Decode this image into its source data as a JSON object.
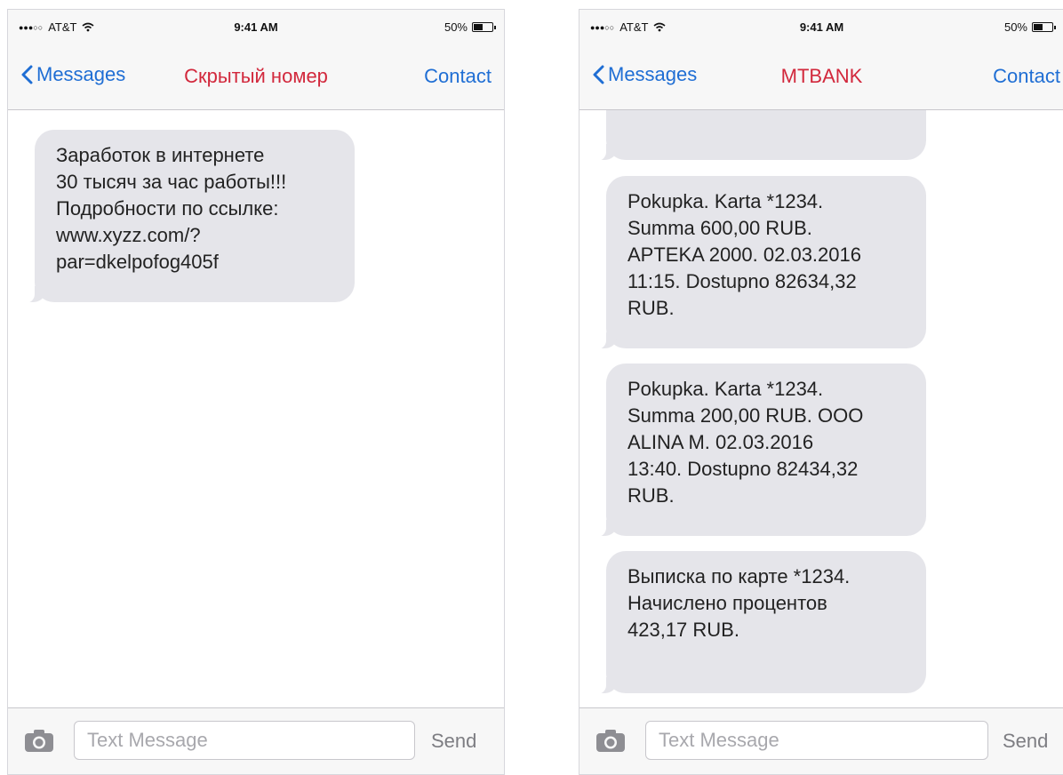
{
  "colors": {
    "nav_link": "#1f6ed4",
    "sender_title": "#d2283c",
    "bubble_incoming": "#e5e5ea",
    "bar_background": "#f7f7f7"
  },
  "phones": [
    {
      "status": {
        "carrier": "AT&T",
        "time": "9:41 AM",
        "battery": "50%",
        "battery_level": 0.5,
        "signal_dots": "●●●○○"
      },
      "nav": {
        "back_label": "Messages",
        "title": "Скрытый номер",
        "contact_label": "Contact"
      },
      "messages": [
        "Заработок в интернете\n30 тысяч за час работы!!!\nПодробности по ссылке:\nwww.xyzz.com/?\npar=dkelpofog405f"
      ],
      "input": {
        "placeholder": "Text Message",
        "send_label": "Send"
      },
      "icons": {
        "back": "chevron-left-icon",
        "camera": "camera-icon",
        "wifi": "wifi-icon",
        "battery": "battery-icon"
      }
    },
    {
      "status": {
        "carrier": "AT&T",
        "time": "9:41 AM",
        "battery": "50%",
        "battery_level": 0.5,
        "signal_dots": "●●●○○"
      },
      "nav": {
        "back_label": "Messages",
        "title": "MTBANK",
        "contact_label": "Contact"
      },
      "messages": [
        "",
        "Pokupka. Karta *1234.\nSumma 600,00 RUB.\nAPTEKA 2000. 02.03.2016\n11:15. Dostupno 82634,32\nRUB.",
        "Pokupka. Karta *1234.\nSumma 200,00 RUB. OOO\nALINA M. 02.03.2016\n13:40. Dostupno 82434,32\nRUB.",
        "Выписка по карте *1234.\nНачислено процентов\n423,17 RUB."
      ],
      "input": {
        "placeholder": "Text Message",
        "send_label": "Send"
      },
      "icons": {
        "back": "chevron-left-icon",
        "camera": "camera-icon",
        "wifi": "wifi-icon",
        "battery": "battery-icon"
      }
    }
  ]
}
